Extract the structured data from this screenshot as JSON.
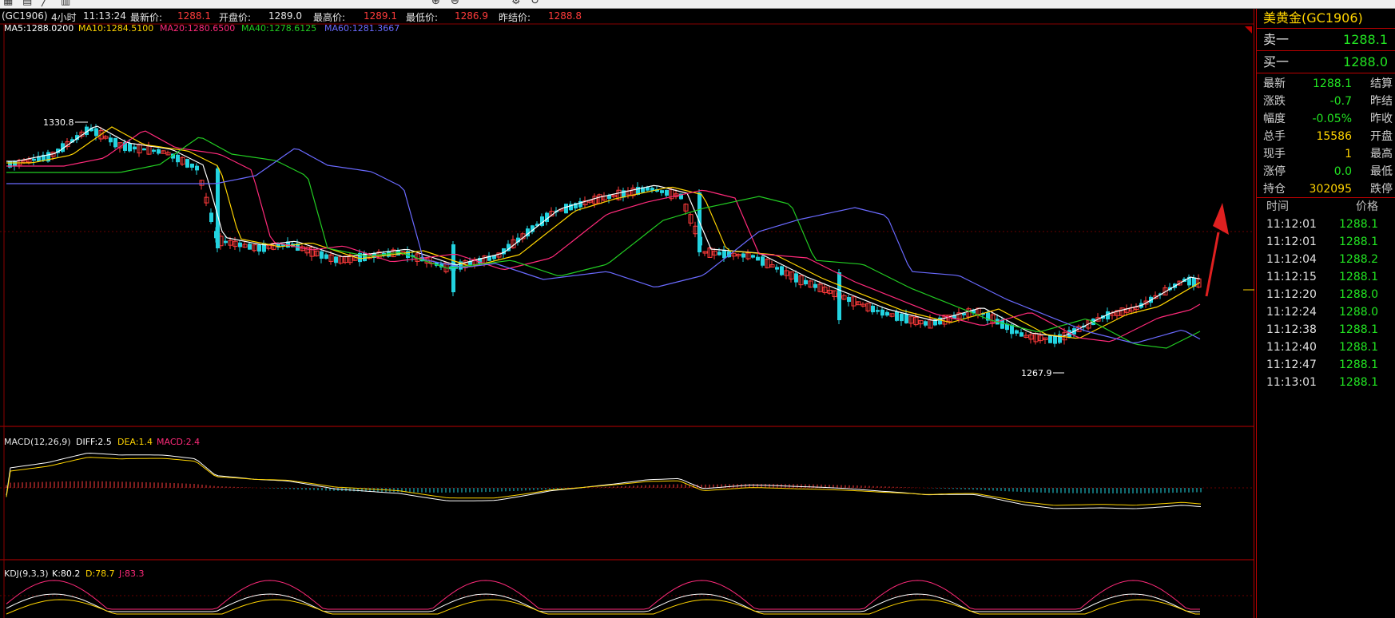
{
  "toolbar": {
    "icons": [
      "chart-icon",
      "grid-icon",
      "line-icon",
      "bar-icon",
      "zoom-in-icon",
      "zoom-out-icon",
      "settings-icon",
      "refresh-icon"
    ]
  },
  "header": {
    "symbol": "(GC1906)",
    "period": "4小时",
    "time": "11:13:24",
    "latest_label": "最新价:",
    "latest": "1288.1",
    "open_label": "开盘价:",
    "open": "1289.0",
    "high_label": "最高价:",
    "high": "1289.1",
    "low_label": "最低价:",
    "low": "1286.9",
    "settle_label": "昨结价:",
    "settle": "1288.8"
  },
  "ma": {
    "ma5": "MA5:1288.0200",
    "ma10": "MA10:1284.5100",
    "ma20": "MA20:1280.6500",
    "ma40": "MA40:1278.6125",
    "ma60": "MA60:1281.3667"
  },
  "annotations": {
    "high_mark": "1330.8",
    "low_mark": "1267.9"
  },
  "macd": {
    "name": "MACD(12,26,9)",
    "diff": "DIFF:2.5",
    "dea": "DEA:1.4",
    "macd": "MACD:2.4"
  },
  "kdj": {
    "name": "KDJ(9,3,3)",
    "k": "K:80.2",
    "d": "D:78.7",
    "j": "J:83.3"
  },
  "colors": {
    "up": "#ff3b3b",
    "down": "#22d3e0",
    "ma5": "#ffffff",
    "ma10": "#ffd400",
    "ma20": "#ff2a7a",
    "ma40": "#22cc22",
    "ma60": "#6a6aff"
  },
  "panel": {
    "title": "美黄金(GC1906)",
    "sell_label": "卖一",
    "sell": "1288.1",
    "buy_label": "买一",
    "buy": "1288.0",
    "stats": [
      {
        "k": "最新",
        "v": "1288.1",
        "k2": "结算",
        "c": "g"
      },
      {
        "k": "涨跌",
        "v": "-0.7",
        "k2": "昨结",
        "c": "g"
      },
      {
        "k": "幅度",
        "v": "-0.05%",
        "k2": "昨收",
        "c": "g"
      },
      {
        "k": "总手",
        "v": "15586",
        "k2": "开盘",
        "c": "y"
      },
      {
        "k": "现手",
        "v": "1",
        "k2": "最高",
        "c": "y"
      },
      {
        "k": "涨停",
        "v": "0.0",
        "k2": "最低",
        "c": "g"
      },
      {
        "k": "持仓",
        "v": "302095",
        "k2": "跌停",
        "c": "y"
      }
    ],
    "ticks_time_label": "时间",
    "ticks_price_label": "价格",
    "ticks": [
      {
        "t": "11:12:01",
        "p": "1288.1"
      },
      {
        "t": "11:12:01",
        "p": "1288.1"
      },
      {
        "t": "11:12:04",
        "p": "1288.2"
      },
      {
        "t": "11:12:15",
        "p": "1288.1"
      },
      {
        "t": "11:12:20",
        "p": "1288.0"
      },
      {
        "t": "11:12:24",
        "p": "1288.0"
      },
      {
        "t": "11:12:38",
        "p": "1288.1"
      },
      {
        "t": "11:12:40",
        "p": "1288.1"
      },
      {
        "t": "11:12:47",
        "p": "1288.1"
      },
      {
        "t": "11:13:01",
        "p": "1288.1"
      }
    ]
  }
}
